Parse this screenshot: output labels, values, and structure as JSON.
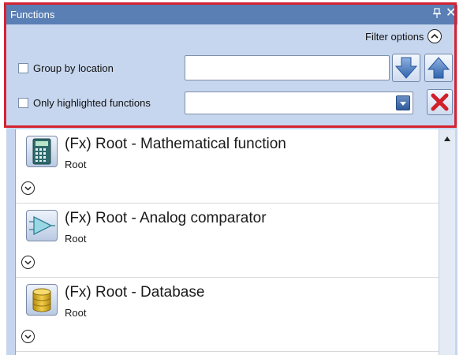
{
  "panel": {
    "title": "Functions",
    "close_glyph": "✕"
  },
  "filter": {
    "options_label": "Filter options",
    "group_by_location_label": "Group by location",
    "group_by_location_checked": false,
    "location_value": "",
    "only_highlighted_label": "Only highlighted functions",
    "only_highlighted_checked": false,
    "highlight_selected_value": ""
  },
  "functions": [
    {
      "name": "(Fx) Root - Mathematical function",
      "location": "Root",
      "icon": "calculator-icon"
    },
    {
      "name": "(Fx) Root - Analog comparator",
      "location": "Root",
      "icon": "comparator-icon"
    },
    {
      "name": "(Fx) Root - Database",
      "location": "Root",
      "icon": "database-icon"
    }
  ],
  "colors": {
    "title_bar": "#5a7fb5",
    "panel_background": "#c6d6ee",
    "highlight_frame": "#d42331",
    "clear_button_x": "#d0202a"
  }
}
